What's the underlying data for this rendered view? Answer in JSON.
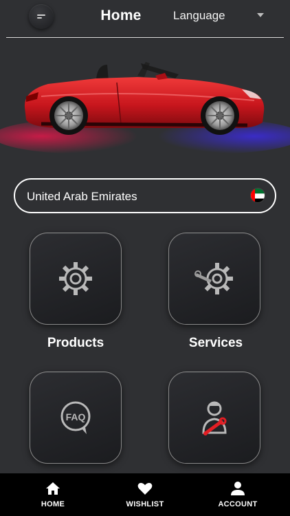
{
  "header": {
    "title": "Home",
    "language_label": "Language",
    "menu_icon": "menu-icon"
  },
  "hero": {
    "image": "red-convertible-sports-car",
    "car_color": "#c8161d"
  },
  "country_field": {
    "value": "United Arab Emirates",
    "flag_icon": "uae-flag-icon"
  },
  "tiles": [
    {
      "label": "Products",
      "icon": "gear-icon"
    },
    {
      "label": "Services",
      "icon": "gear-wrench-icon"
    },
    {
      "label": "",
      "icon": "faq-icon"
    },
    {
      "label": "",
      "icon": "mechanic-icon"
    }
  ],
  "bottom_nav": [
    {
      "label": "HOME",
      "icon": "home-icon"
    },
    {
      "label": "WISHLIST",
      "icon": "heart-icon"
    },
    {
      "label": "ACCOUNT",
      "icon": "user-icon"
    }
  ],
  "colors": {
    "background": "#2f3033",
    "nav_background": "#000000",
    "accent_red": "#e31e24"
  }
}
